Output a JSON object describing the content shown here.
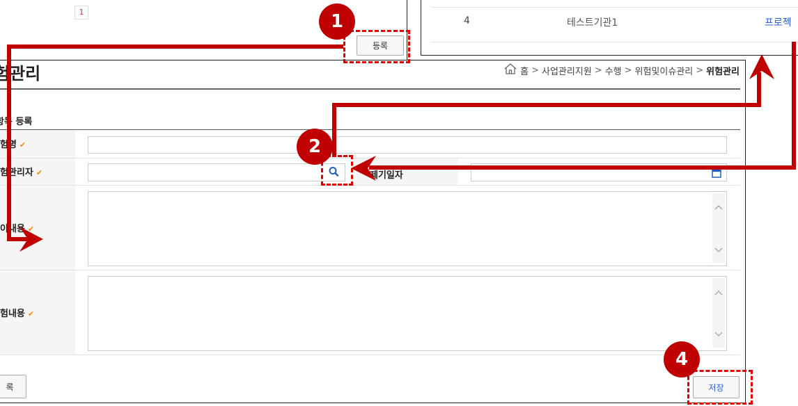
{
  "top_left": {
    "page_number": "1",
    "register_label": "등록"
  },
  "top_right": {
    "row": {
      "no": "4",
      "org_name": "테스트기관1",
      "link_partial": "프로젝"
    }
  },
  "page_title": "험관리",
  "breadcrumb": {
    "items": [
      "홈",
      "사업관리지원",
      "수행",
      "위험및이슈관리"
    ],
    "current": "위험관리"
  },
  "form": {
    "section_title": "항목 등록",
    "fields": [
      {
        "label": "험명"
      },
      {
        "label": "험관리자"
      },
      {
        "label": "제기일자"
      },
      {
        "label": "이내용"
      },
      {
        "label": "험내용"
      }
    ]
  },
  "buttons": {
    "save_label": "저장",
    "register_label": "록"
  },
  "annotations": {
    "markers": [
      "1",
      "2",
      "4"
    ]
  },
  "colors": {
    "annotation_red": "#c00000",
    "link_blue": "#2a5fd8",
    "required_check": "#f08c00"
  },
  "icons": {
    "search": "search-icon",
    "calendar": "calendar-icon",
    "home": "home-icon"
  }
}
